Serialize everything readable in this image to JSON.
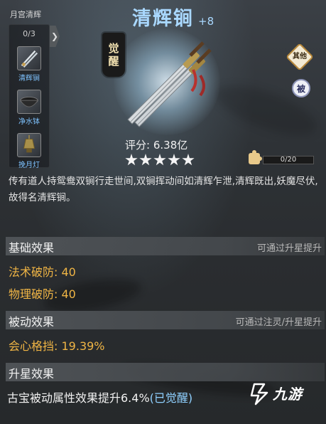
{
  "left_panel": {
    "title": "月宫清辉",
    "count": "0/3",
    "arrow": "❯",
    "items": [
      {
        "label": "清辉锏",
        "icon": "twin-mace-icon"
      },
      {
        "label": "净水钵",
        "icon": "bowl-icon"
      },
      {
        "label": "挽月灯",
        "icon": "lamp-icon"
      }
    ]
  },
  "header": {
    "title": "清辉锏",
    "level": "+8"
  },
  "seal": {
    "line1": "觉",
    "line2": "醒"
  },
  "badges": {
    "other": "其他",
    "passive": "被"
  },
  "score": {
    "label": "评分:",
    "value": "6.38亿",
    "stars": 5
  },
  "fragments": {
    "text": "0/20",
    "fraction": 0.0
  },
  "description": "传有道人持鸳鸯双锏行走世间,双锏挥动间如清辉乍泄,清辉既出,妖魔尽伏,故得名清辉锏。",
  "sections": {
    "base": {
      "name": "基础效果",
      "hint": "可通过升星提升",
      "stats": [
        {
          "label": "法术破防:",
          "value": "40"
        },
        {
          "label": "物理破防:",
          "value": "40"
        }
      ]
    },
    "passive": {
      "name": "被动效果",
      "hint": "可通过注灵/升星提升",
      "stats": [
        {
          "label": "会心格挡:",
          "value": "19.39%"
        }
      ]
    },
    "star": {
      "name": "升星效果",
      "text": "古宝被动属性效果提升6.4%",
      "status": "(已觉醒)"
    }
  },
  "watermark": {
    "text": "九游"
  },
  "colors": {
    "title": "#a9d8ff",
    "stat": "#f0b545",
    "item_label": "#7fc3ff",
    "awakened": "#8fd0ff"
  }
}
